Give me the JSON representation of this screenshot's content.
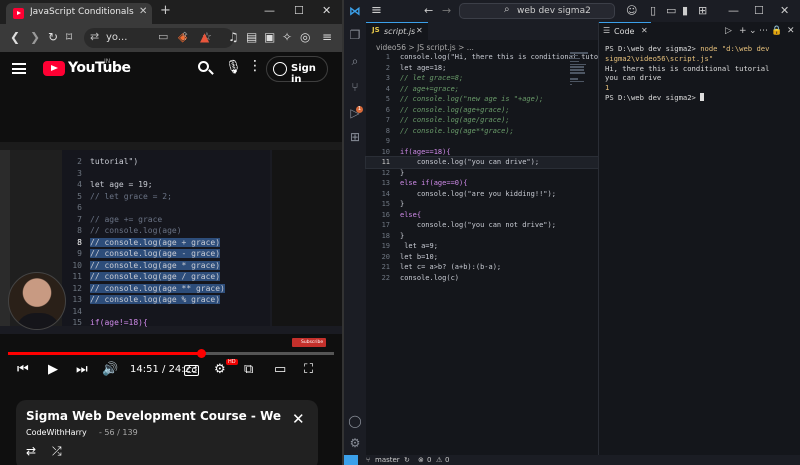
{
  "browser": {
    "tab_title": "JavaScript Conditionals: if, else, else if",
    "tab_close": "✕",
    "new_tab": "+",
    "address_text": "yo...",
    "window_min": "—",
    "window_max": "☐",
    "window_close": "✕"
  },
  "youtube": {
    "logo_text": "YouTube",
    "country_code": "IN",
    "sign_in_label": "Sign in",
    "video_code": {
      "lines": [
        {
          "n": "2",
          "code": "tutorial\")",
          "cls": ""
        },
        {
          "n": "3",
          "code": "",
          "cls": ""
        },
        {
          "n": "4",
          "code": "let age = 19;",
          "cls": ""
        },
        {
          "n": "5",
          "code": "// let grace = 2;",
          "cls": "cm"
        },
        {
          "n": "6",
          "code": "",
          "cls": ""
        },
        {
          "n": "7",
          "code": "// age += grace",
          "cls": "cm"
        },
        {
          "n": "8",
          "code": "// console.log(age)",
          "cls": "cm"
        },
        {
          "n": "8",
          "code": "// console.log(age + grace)",
          "cls": "hl"
        },
        {
          "n": "9",
          "code": "// console.log(age - grace)",
          "cls": "hl"
        },
        {
          "n": "10",
          "code": "// console.log(age * grace)",
          "cls": "hl"
        },
        {
          "n": "11",
          "code": "// console.log(age / grace)",
          "cls": "hl"
        },
        {
          "n": "12",
          "code": "// console.log(age ** grace)",
          "cls": "hl"
        },
        {
          "n": "13",
          "code": "// console.log(age % grace)",
          "cls": "hl"
        },
        {
          "n": "14",
          "code": "",
          "cls": ""
        },
        {
          "n": "15",
          "code": "if(age!=18){",
          "cls": "kw"
        }
      ]
    },
    "subscribe_label": "Subscribe",
    "player": {
      "current_time": "14:51",
      "duration": "24:23",
      "time_separator": " / ",
      "progress_fraction": 0.595,
      "hd_badge": "HD"
    },
    "playlist_card": {
      "title": "Sigma Web Development Course - Web Development Tutorials",
      "channel": "CodeWithHarry",
      "position": "- 56 / 139"
    }
  },
  "vscode": {
    "search_text": "web dev sigma2",
    "tab_file": "script.js",
    "tab_badge": "JS",
    "breadcrumb": "video56 > JS script.js > ...",
    "current_line": 11,
    "code_lines": [
      {
        "n": "1",
        "code": "console.log(\"Hi, there this is conditional tutorial\")",
        "cls": ""
      },
      {
        "n": "2",
        "code": "let age=18;",
        "cls": ""
      },
      {
        "n": "3",
        "code": "// let grace=8;",
        "cls": "cm"
      },
      {
        "n": "4",
        "code": "// age+=grace;",
        "cls": "cm"
      },
      {
        "n": "5",
        "code": "// console.log(\"new age is \"+age);",
        "cls": "cm"
      },
      {
        "n": "6",
        "code": "// console.log(age+grace);",
        "cls": "cm"
      },
      {
        "n": "7",
        "code": "// console.log(age/grace);",
        "cls": "cm"
      },
      {
        "n": "8",
        "code": "// console.log(age**grace);",
        "cls": "cm"
      },
      {
        "n": "9",
        "code": "",
        "cls": ""
      },
      {
        "n": "10",
        "code": "if(age==18){",
        "cls": "kw"
      },
      {
        "n": "11",
        "code": "    console.log(\"you can drive\");",
        "cls": ""
      },
      {
        "n": "12",
        "code": "}",
        "cls": ""
      },
      {
        "n": "13",
        "code": "else if(age==0){",
        "cls": "kw"
      },
      {
        "n": "14",
        "code": "    console.log(\"are you kidding!!\");",
        "cls": ""
      },
      {
        "n": "15",
        "code": "}",
        "cls": ""
      },
      {
        "n": "16",
        "code": "else{",
        "cls": "kw"
      },
      {
        "n": "17",
        "code": "    console.log(\"you can not drive\");",
        "cls": ""
      },
      {
        "n": "18",
        "code": "}",
        "cls": ""
      },
      {
        "n": "19",
        "code": " let a=9;",
        "cls": ""
      },
      {
        "n": "20",
        "code": "let b=10;",
        "cls": ""
      },
      {
        "n": "21",
        "code": "let c= a>b? (a+b):(b-a);",
        "cls": ""
      },
      {
        "n": "22",
        "code": "console.log(c)",
        "cls": ""
      }
    ],
    "panel_tab": "Code",
    "terminal": {
      "prompt1": "PS D:\\web dev sigma2> ",
      "command": "node \"d:\\web dev sigma2\\video56\\script.js\"",
      "out1": "Hi, there this is conditional tutorial",
      "out2": "you can drive",
      "out3": "1",
      "prompt2": "PS D:\\web dev sigma2> "
    },
    "status": {
      "branch": "master",
      "errors": "0",
      "warnings": "0"
    }
  }
}
